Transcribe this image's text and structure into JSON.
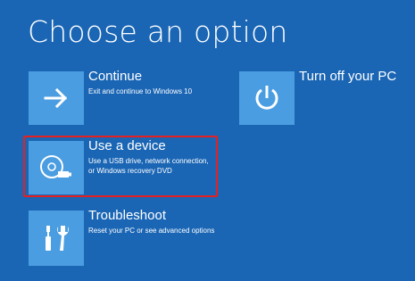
{
  "page": {
    "title": "Choose an option"
  },
  "options": {
    "continue": {
      "title": "Continue",
      "description": "Exit and continue to Windows 10",
      "icon": "arrow-right-icon"
    },
    "use_device": {
      "title": "Use a device",
      "description_line1": "Use a USB drive, network connection,",
      "description_line2": "or Windows recovery DVD",
      "icon": "disc-icon"
    },
    "troubleshoot": {
      "title": "Troubleshoot",
      "description": "Reset your PC or see advanced options",
      "icon": "tools-icon"
    },
    "turn_off": {
      "title": "Turn off your PC",
      "icon": "power-icon"
    }
  },
  "colors": {
    "background": "#1a66b5",
    "tile": "#4a9de0",
    "highlight": "#e62020"
  }
}
